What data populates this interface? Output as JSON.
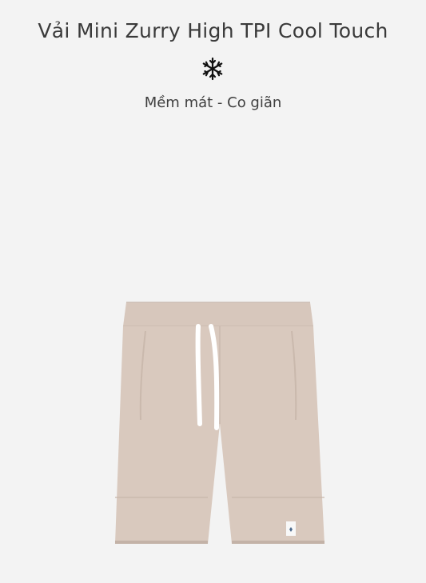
{
  "product": {
    "title": "Vải Mini Zurry High TPI Cool Touch",
    "subtitle": "Mềm mát - Co giãn",
    "icon": "snowflake-icon",
    "image_alt": "shorts-image"
  },
  "colors": {
    "background": "#f3f3f3",
    "text": "#3a3a3a",
    "shorts": "#d8c8bd",
    "shorts_shadow": "#c7b6aa",
    "drawstring": "#ffffff"
  }
}
